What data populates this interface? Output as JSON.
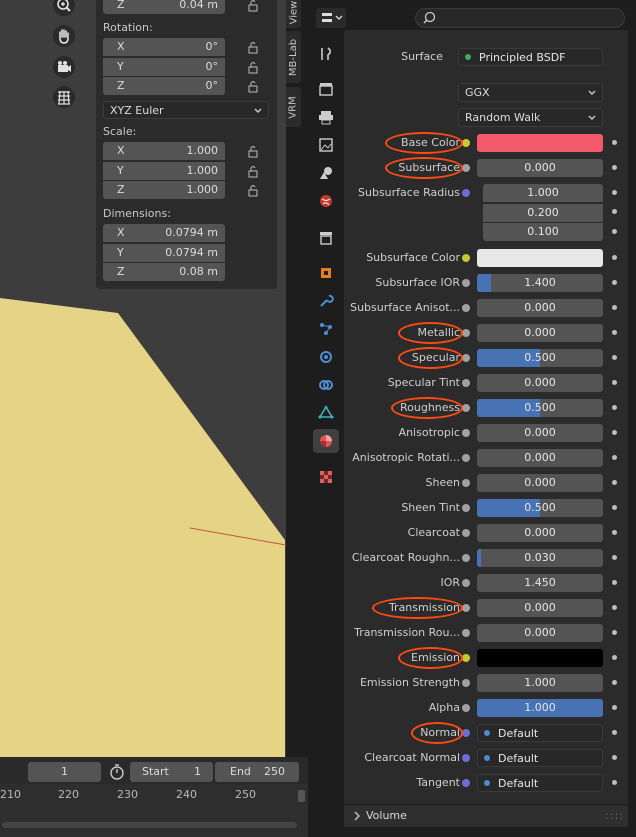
{
  "viewport": {
    "npanel": {
      "location_z": {
        "axis": "Z",
        "value": "0.04 m"
      },
      "rotation_label": "Rotation:",
      "rotation": [
        {
          "axis": "X",
          "value": "0°"
        },
        {
          "axis": "Y",
          "value": "0°"
        },
        {
          "axis": "Z",
          "value": "0°"
        }
      ],
      "rotation_mode": "XYZ Euler",
      "scale_label": "Scale:",
      "scale": [
        {
          "axis": "X",
          "value": "1.000"
        },
        {
          "axis": "Y",
          "value": "1.000"
        },
        {
          "axis": "Z",
          "value": "1.000"
        }
      ],
      "dimensions_label": "Dimensions:",
      "dimensions": [
        {
          "axis": "X",
          "value": "0.0794 m"
        },
        {
          "axis": "Y",
          "value": "0.0794 m"
        },
        {
          "axis": "Z",
          "value": "0.08 m"
        }
      ]
    },
    "tabs": [
      "View",
      "MB-Lab",
      "VRM"
    ],
    "tools": [
      "zoom-icon",
      "hand-icon",
      "camera-icon",
      "grid-icon"
    ],
    "object_color": "#e6d486",
    "background_color": "#3d3d3d"
  },
  "timeline": {
    "current_frame": "1",
    "start_label": "Start",
    "start_value": "1",
    "end_label": "End",
    "end_value": "250",
    "ticks": [
      "210",
      "220",
      "230",
      "240",
      "250"
    ]
  },
  "properties": {
    "surface_label": "Surface",
    "surface_value": "Principled BSDF",
    "distribution": "GGX",
    "subsurface_method": "Random Walk",
    "rows": [
      {
        "label": "Base Color",
        "type": "color",
        "color": "#f25a6c",
        "socket": "#c8c832",
        "highlight": true
      },
      {
        "label": "Subsurface",
        "type": "value",
        "value": "0.000",
        "fill": 0,
        "highlight": true
      },
      {
        "label": "Subsurface Radius",
        "type": "vector",
        "values": [
          "1.000",
          "0.200",
          "0.100"
        ],
        "socket": "#6d6dd6"
      },
      {
        "label": "Subsurface Color",
        "type": "color",
        "color": "#e8e8e8",
        "socket": "#c8c832"
      },
      {
        "label": "Subsurface IOR",
        "type": "value",
        "value": "1.400",
        "fill": 0.11
      },
      {
        "label": "Subsurface Anisot...",
        "type": "value",
        "value": "0.000",
        "fill": 0
      },
      {
        "label": "Metallic",
        "type": "value",
        "value": "0.000",
        "fill": 0,
        "highlight": true
      },
      {
        "label": "Specular",
        "type": "value",
        "value": "0.500",
        "fill": 0.5,
        "highlight": true
      },
      {
        "label": "Specular Tint",
        "type": "value",
        "value": "0.000",
        "fill": 0
      },
      {
        "label": "Roughness",
        "type": "value",
        "value": "0.500",
        "fill": 0.5,
        "highlight": true
      },
      {
        "label": "Anisotropic",
        "type": "value",
        "value": "0.000",
        "fill": 0
      },
      {
        "label": "Anisotropic Rotati...",
        "type": "value",
        "value": "0.000",
        "fill": 0
      },
      {
        "label": "Sheen",
        "type": "value",
        "value": "0.000",
        "fill": 0
      },
      {
        "label": "Sheen Tint",
        "type": "value",
        "value": "0.500",
        "fill": 0.5
      },
      {
        "label": "Clearcoat",
        "type": "value",
        "value": "0.000",
        "fill": 0
      },
      {
        "label": "Clearcoat Roughn...",
        "type": "value",
        "value": "0.030",
        "fill": 0.03
      },
      {
        "label": "IOR",
        "type": "value",
        "value": "1.450",
        "fill": 0
      },
      {
        "label": "Transmission",
        "type": "value",
        "value": "0.000",
        "fill": 0,
        "highlight": true
      },
      {
        "label": "Transmission Rou...",
        "type": "value",
        "value": "0.000",
        "fill": 0
      },
      {
        "label": "Emission",
        "type": "color",
        "color": "#000000",
        "socket": "#c8c832",
        "highlight": true
      },
      {
        "label": "Emission Strength",
        "type": "value",
        "value": "1.000",
        "fill": 0
      },
      {
        "label": "Alpha",
        "type": "value",
        "value": "1.000",
        "fill": 1
      },
      {
        "label": "Normal",
        "type": "link",
        "value": "Default",
        "socket": "#6d6dd6",
        "highlight": true
      },
      {
        "label": "Clearcoat Normal",
        "type": "link",
        "value": "Default",
        "socket": "#6d6dd6"
      },
      {
        "label": "Tangent",
        "type": "link",
        "value": "Default",
        "socket": "#6d6dd6"
      }
    ],
    "volume_label": "Volume",
    "highlight_color": "#ff4b14"
  }
}
